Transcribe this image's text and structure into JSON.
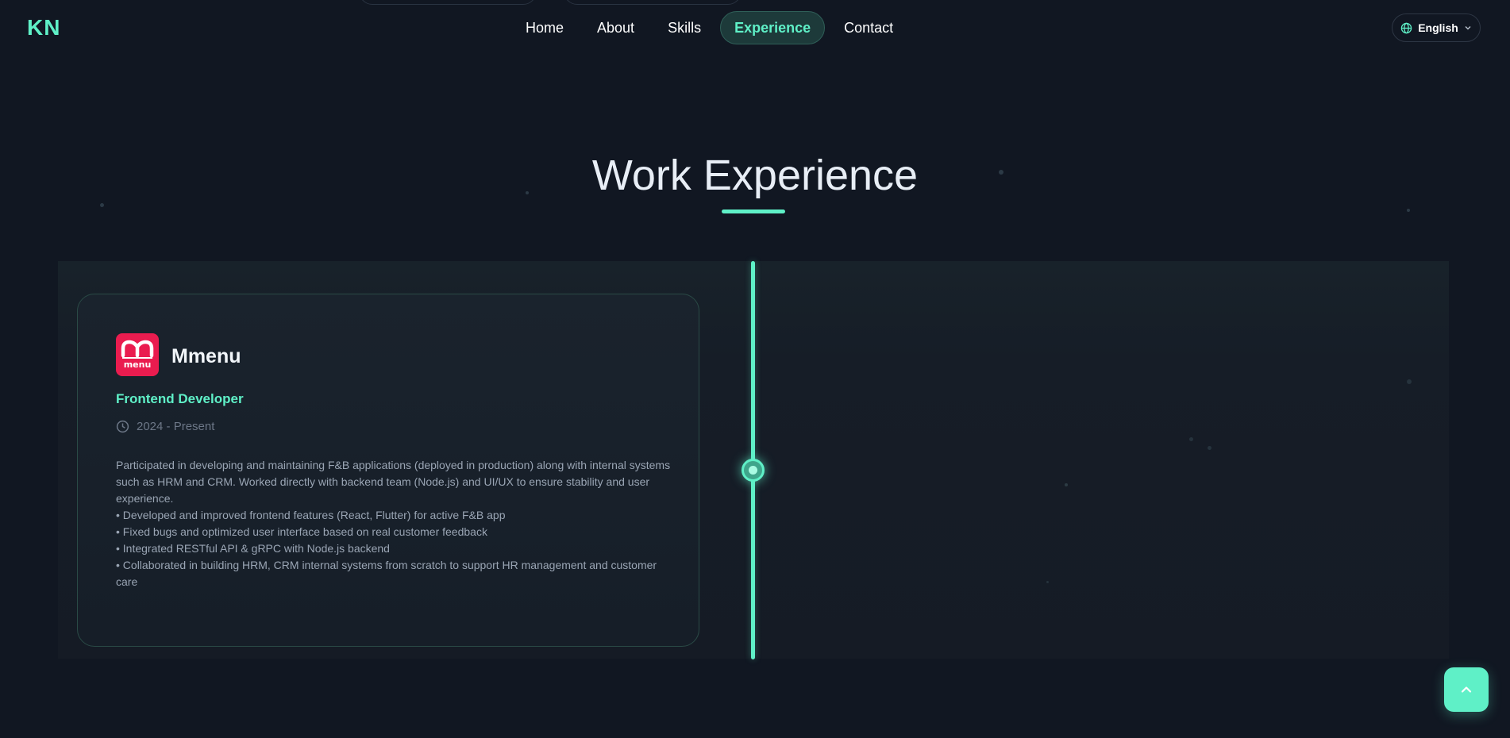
{
  "nav": {
    "brand": "KN",
    "links": [
      {
        "label": "Home"
      },
      {
        "label": "About"
      },
      {
        "label": "Skills"
      },
      {
        "label": "Experience"
      },
      {
        "label": "Contact"
      }
    ],
    "active": "Experience",
    "language": "English"
  },
  "section": {
    "title": "Work Experience"
  },
  "experience": {
    "company": "Mmenu",
    "logo_text": "menu",
    "role": "Frontend Developer",
    "period": "2024 - Present",
    "summary": "Participated in developing and maintaining F&B applications (deployed in production) along with internal systems such as HRM and CRM. Worked directly with backend team (Node.js) and UI/UX to ensure stability and user experience.",
    "bullets": [
      "Developed and improved frontend features (React, Flutter) for active F&B app",
      "Fixed bugs and optimized user interface based on real customer feedback",
      "Integrated RESTful API & gRPC with Node.js backend",
      "Collaborated in building HRM, CRM internal systems from scratch to support HR management and customer care"
    ]
  },
  "colors": {
    "accent": "#5ff0c7",
    "background": "#111722",
    "logo": "#ea1c4f"
  },
  "icons": {
    "language": "globe-icon",
    "dropdown": "chevron-down-icon",
    "period": "clock-icon",
    "scroll_top": "chevron-up-icon"
  }
}
